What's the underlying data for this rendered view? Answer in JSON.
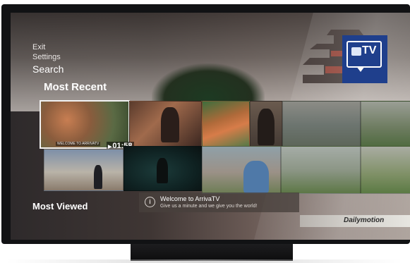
{
  "menu": {
    "items": [
      "Exit",
      "Settings",
      "Search"
    ]
  },
  "sections": {
    "most_recent": "Most Recent",
    "most_viewed": "Most Viewed"
  },
  "featured_video": {
    "caption": "WELCOME TO ARRIVATV",
    "duration": "01:58"
  },
  "logo": {
    "text": "TV"
  },
  "toast": {
    "title": "Welcome to ArrivaTV",
    "subtitle": "Give us a minute and we give you the world!",
    "icon": "info-icon"
  },
  "branding": {
    "provider": "Dailymotion"
  },
  "colors": {
    "logo_bg": "#1f3f8c",
    "toast_bg": "#48403c"
  }
}
